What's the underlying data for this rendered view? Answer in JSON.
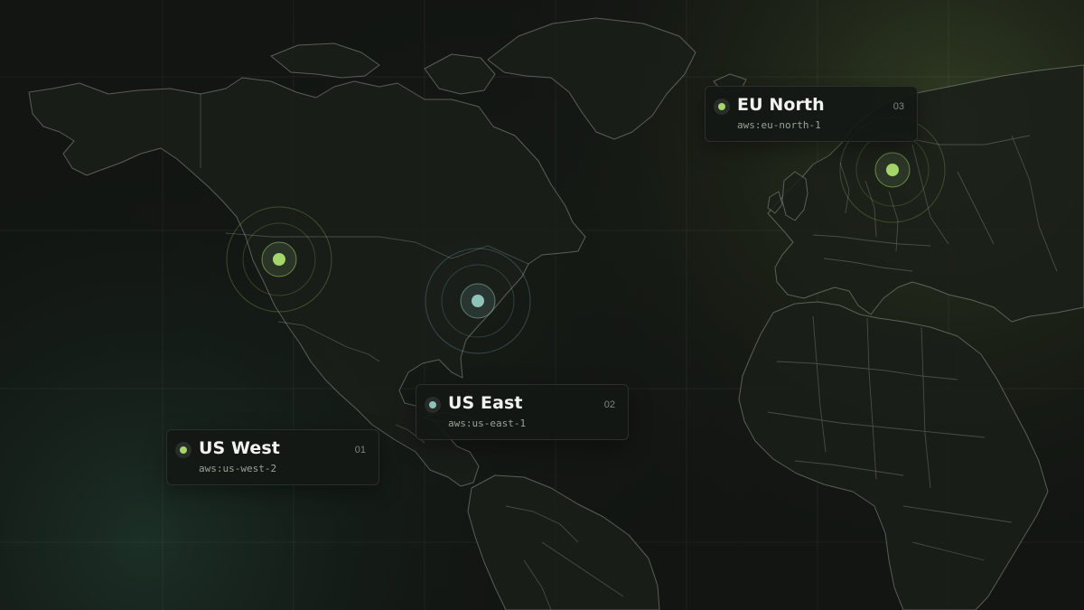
{
  "map": {
    "basemap": "dark world map with country borders",
    "theme_colors": {
      "background": "#121512",
      "land_stroke": "#8f978c",
      "accent_green": "#a6d66b",
      "accent_teal": "#8fc2b9"
    }
  },
  "regions": [
    {
      "name": "US West",
      "code": "aws:us-west-2",
      "index": "01",
      "dot_color": "#a6d66b"
    },
    {
      "name": "US East",
      "code": "aws:us-east-1",
      "index": "02",
      "dot_color": "#8fc2b9"
    },
    {
      "name": "EU North",
      "code": "aws:eu-north-1",
      "index": "03",
      "dot_color": "#a6d66b"
    }
  ]
}
